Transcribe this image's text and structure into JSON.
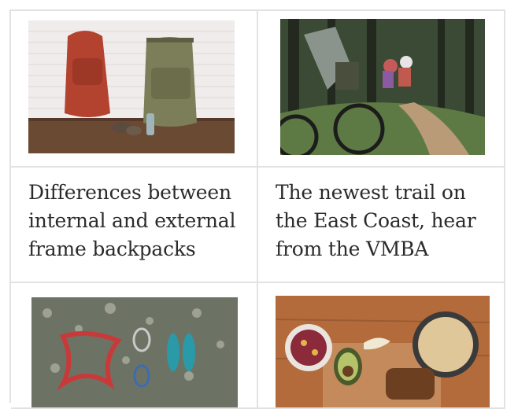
{
  "cards": [
    {
      "id": "backpacks",
      "image_alt": "Two hiking backpacks, a red one and a green one, with boots and bottles on a wooden floor",
      "title": "Differences between internal and external frame backpacks"
    },
    {
      "id": "trail",
      "image_alt": "Three mountain bikers riding on a forest trail",
      "title": "The newest trail on the East Coast, hear from the VMBA"
    },
    {
      "id": "climbing",
      "image_alt": "Climbing gear: harness, shoes, carabiners and helmet on rocky ground"
    },
    {
      "id": "breakfast",
      "image_alt": "Breakfast foods: cereal, avocado, berries and bread on a wooden board"
    }
  ]
}
